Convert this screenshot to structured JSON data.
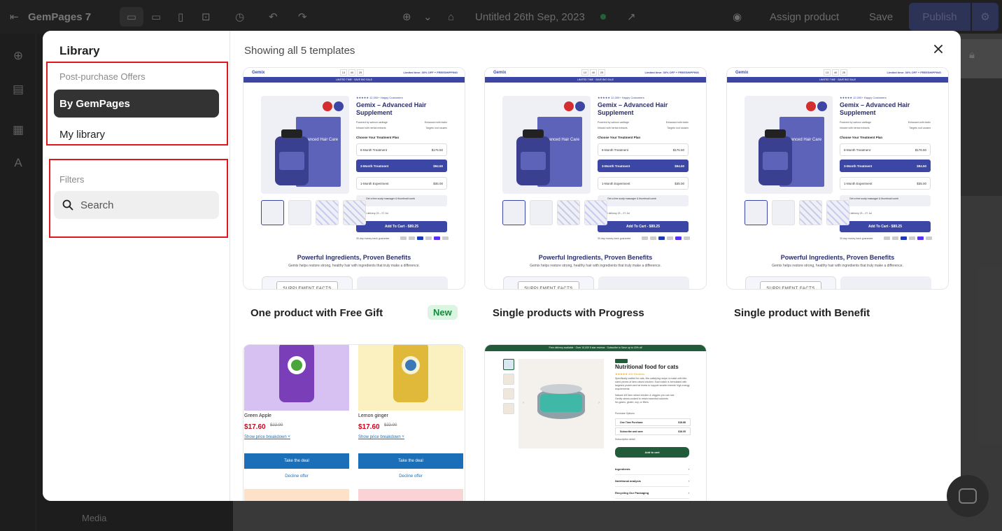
{
  "app": {
    "name": "GemPages 7",
    "page_title": "Untitled 26th Sep, 2023",
    "assign_product": "Assign product",
    "save": "Save",
    "publish": "Publish",
    "media_label": "Media"
  },
  "library": {
    "title": "Library",
    "section_label": "Post-purchase Offers",
    "nav": [
      {
        "label": "By GemPages",
        "active": true
      },
      {
        "label": "My library",
        "active": false
      }
    ],
    "filters_label": "Filters",
    "search_placeholder": "Search"
  },
  "main": {
    "showing_text": "Showing all 5 templates",
    "close_icon": "close-icon",
    "templates": [
      {
        "name": "One product with Free Gift",
        "badge": "New"
      },
      {
        "name": "Single products with Progress"
      },
      {
        "name": "Single product with Benefit"
      },
      {
        "name": ""
      },
      {
        "name": ""
      }
    ]
  },
  "gemix": {
    "logo": "Gemix",
    "timer": [
      "13",
      "40",
      "25"
    ],
    "limited": "Limited time: 30% OFF + FREESHIPPING",
    "stripe": "LIMITED TIME · SAVE BIG SALE",
    "stars": "★★★★★ 12,000+ Happy Customers",
    "title": "Gemix – Advanced Hair Supplement",
    "features": [
      "Powered by salmon cartilage",
      "Enhanced with biotin",
      "Infused with herbal extracts",
      "Targets root causes"
    ],
    "plan_heading": "Choose Your Treatment Plan",
    "plans": [
      {
        "name": "6-Month Treatment",
        "price": "$176.50"
      },
      {
        "name": "3-Month Treatment",
        "price": "$94.50"
      },
      {
        "name": "1-Month Experiment",
        "price": "$35.00"
      }
    ],
    "box_text": "Advanced Hair Care",
    "gift": "Get a free scalp massager & thumbnail comb",
    "delivery": "Expected delivery 23 – 27 Jul",
    "cart": "Add To Cart - $89.25",
    "guarantee": "30-day money-back guarantee",
    "h2": "Powerful Ingredients, Proven Benefits",
    "sub": "Gemix helps restore strong, healthy hair with ingredients that truly make a difference.",
    "facts": "SUPPLEMENT FACTS"
  },
  "drinks": {
    "items": [
      {
        "name": "Green Apple",
        "price": "$17.60",
        "old": "$22.00"
      },
      {
        "name": "Lemon ginger",
        "price": "$17.60",
        "old": "$22.00"
      }
    ],
    "breakdown": "Show price breakdown ˅",
    "take": "Take the deal",
    "decline": "Decline offer"
  },
  "catfood": {
    "bar": "Free delivery available  ·  Over 10,000 5 star reviews  ·  Subscribe to Save up to 15% off",
    "title": "Nutritional food for cats",
    "stars": "★★★★★ 492 Reviews",
    "desc": "Specifically crafted for cats, this satisfying recipe is made with bite-sized pieces of farm-raised chicken. Each batch is formulated with targeted protein and fat levels to support smaller breeds' high energy requirements.",
    "bullets": [
      "Natural 4/5 farm raised chicken & veggies you can see",
      "Gently steam-cooked to retain essential nutrients",
      "No grains, gluten, soy, or fillers"
    ],
    "options_heading": "Purchase Options",
    "options": [
      {
        "name": "One Time Purchase",
        "price": "$18.88"
      },
      {
        "name": "Subscribe and save",
        "price": "$16.05"
      }
    ],
    "subscription": "Subscription detail",
    "add": "Add to cart",
    "accordion": [
      "Ingredients",
      "Nutritional analysis",
      "Recycling Our Packaging"
    ]
  }
}
